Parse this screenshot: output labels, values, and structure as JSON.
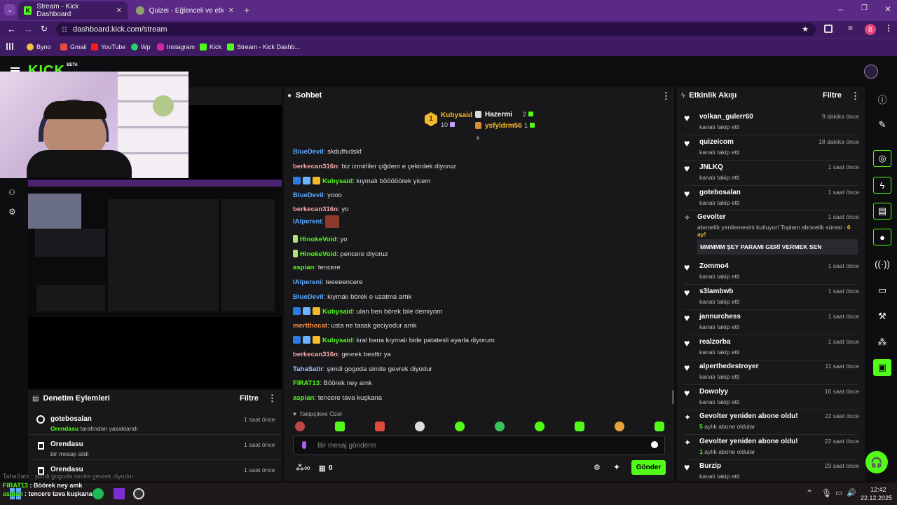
{
  "browser": {
    "tabs": [
      {
        "label": "Stream - Kick Dashboard"
      },
      {
        "label": "Quizei - Eğlenceli ve etkileşimli"
      }
    ],
    "url": "dashboard.kick.com/stream",
    "profile_initial": "B",
    "bookmarks": [
      "Byno",
      "Gmail",
      "YouTube",
      "Wp",
      "Instagram",
      "Kick",
      "Stream - Kick Dashb..."
    ]
  },
  "app": {
    "logo": "KICK",
    "logo_badge": "BETA"
  },
  "chat": {
    "title": "Sohbet",
    "leaderboard": [
      {
        "rank": "1",
        "name": "Kubysaid",
        "count": "10"
      },
      {
        "name": "Hazermi",
        "count": "2"
      },
      {
        "name": "ysfyldrm56",
        "count": "1"
      }
    ],
    "messages": [
      {
        "user": "BlueDevil",
        "text": "skdufhıdskf",
        "color": "#5aa9ff"
      },
      {
        "user": "berkecan316n",
        "text": "biz izmirliler çiğdem e çekirdek diyoruz",
        "color": "#f4a7a7"
      },
      {
        "user": "Kubysaid",
        "text": "kıymalı bööööörek yicem",
        "color": "#53fc18"
      },
      {
        "user": "BlueDevil",
        "text": "yooo",
        "color": "#5aa9ff"
      },
      {
        "user": "berkecan316n",
        "text": "yo",
        "color": "#f4a7a7"
      },
      {
        "user": "IAlpereni",
        "text": "",
        "color": "#5aa9ff"
      },
      {
        "user": "HinokeVoid",
        "text": "yo",
        "color": "#53fc18"
      },
      {
        "user": "HinokeVoid",
        "text": "pencere diyoruz",
        "color": "#53fc18"
      },
      {
        "user": "aspian",
        "text": "tencere",
        "color": "#53fc18"
      },
      {
        "user": "IAlpereni",
        "text": "teeeeencere",
        "color": "#5aa9ff"
      },
      {
        "user": "BlueDevil",
        "text": "kıymalı börek o uzatma artık",
        "color": "#5aa9ff"
      },
      {
        "user": "Kubysaid",
        "text": "ulan ben börek bile demiyom",
        "color": "#53fc18"
      },
      {
        "user": "mertthecat",
        "text": "usta ne tasak geciyodur amk",
        "color": "#ff8c3a"
      },
      {
        "user": "Kubysaid",
        "text": "kral bana kıymalı bide patatesli ayarla diyorum",
        "color": "#53fc18"
      },
      {
        "user": "berkecan316n",
        "text": "gevrek besttir ya",
        "color": "#f4a7a7"
      },
      {
        "user": "TahaSatir",
        "text": "şimdi gogoda simite gevrek diyodur",
        "color": "#9fc3ff"
      },
      {
        "user": "FIRAT13",
        "text": "Böörek ney amk",
        "color": "#53fc18"
      },
      {
        "user": "aspian",
        "text": "tencere tava kuşkana",
        "color": "#53fc18"
      }
    ],
    "followers_only": "Takipçilere Özel",
    "input_placeholder": "Bir mesaj gönderin",
    "points": "0",
    "send_label": "Gönder"
  },
  "mod": {
    "title": "Denetim Eylemleri",
    "filter": "Filtre",
    "items": [
      {
        "name": "gotebosalan",
        "desc_user": "Orendasu",
        "desc": " tarafından yasaklandı",
        "time": "1 saat önce"
      },
      {
        "name": "Orendasu",
        "desc_user": "",
        "desc": "bir mesajı sildi",
        "time": "1 saat önce"
      },
      {
        "name": "Orendasu",
        "desc_user": "",
        "desc": "",
        "time": "1 saat önce"
      }
    ]
  },
  "activity": {
    "title": "Etkinlik Akışı",
    "filter": "Filtre",
    "items": [
      {
        "name": "volkan_gulerr60",
        "sub": "kanalı takip etti",
        "time": "9 dakika önce"
      },
      {
        "name": "quizeicom",
        "sub": "kanalı takip etti",
        "time": "18 dakika önce"
      },
      {
        "name": "JNLKQ",
        "sub": "kanalı takip etti",
        "time": "1 saat önce"
      },
      {
        "name": "gotebosalan",
        "sub": "kanalı takip etti",
        "time": "1 saat önce"
      }
    ],
    "sub": {
      "name": "Gevolter",
      "time": "1 saat önce",
      "text": "abonelik yenilemesini kutluyor! Toplam abonelik süresi - ",
      "months": "6 ay!",
      "message": "MMMMM ŞEY PARAMI GERİ VERMEK SEN"
    },
    "items2": [
      {
        "name": "Zommo4",
        "sub": "kanalı takip etti",
        "time": "1 saat önce"
      },
      {
        "name": "s3lambwb",
        "sub": "kanalı takip etti",
        "time": "1 saat önce"
      },
      {
        "name": "jannurchess",
        "sub": "kanalı takip etti",
        "time": "1 saat önce"
      },
      {
        "name": "realzorba",
        "sub": "kanalı takip etti",
        "time": "1 saat önce"
      },
      {
        "name": "alperthedestroyer",
        "sub": "kanalı takip etti",
        "time": "11 saat önce"
      },
      {
        "name": "Dowolyy",
        "sub": "kanalı takip etti",
        "time": "16 saat önce"
      }
    ],
    "resubs": [
      {
        "name": "Gevolter yeniden abone oldu!",
        "num": "5",
        "sub": " aylık abone oldular",
        "time": "22 saat önce"
      },
      {
        "name": "Gevolter yeniden abone oldu!",
        "num": "1",
        "sub": " aylık abone oldular",
        "time": "22 saat önce"
      }
    ],
    "last": {
      "name": "Burzip",
      "sub": "kanalı takip etti",
      "time": "23 saat önce"
    }
  },
  "overlay": [
    {
      "user": "TahaSatir",
      "text": "şimdi gogoda simite gevrek diyodur"
    },
    {
      "user": "FIRAT13",
      "text": "Böörek ney amk"
    },
    {
      "user": "aspian",
      "text": "tencere tava kuşkana"
    }
  ],
  "taskbar": {
    "time": "12:42",
    "date": "22.12.2025"
  }
}
